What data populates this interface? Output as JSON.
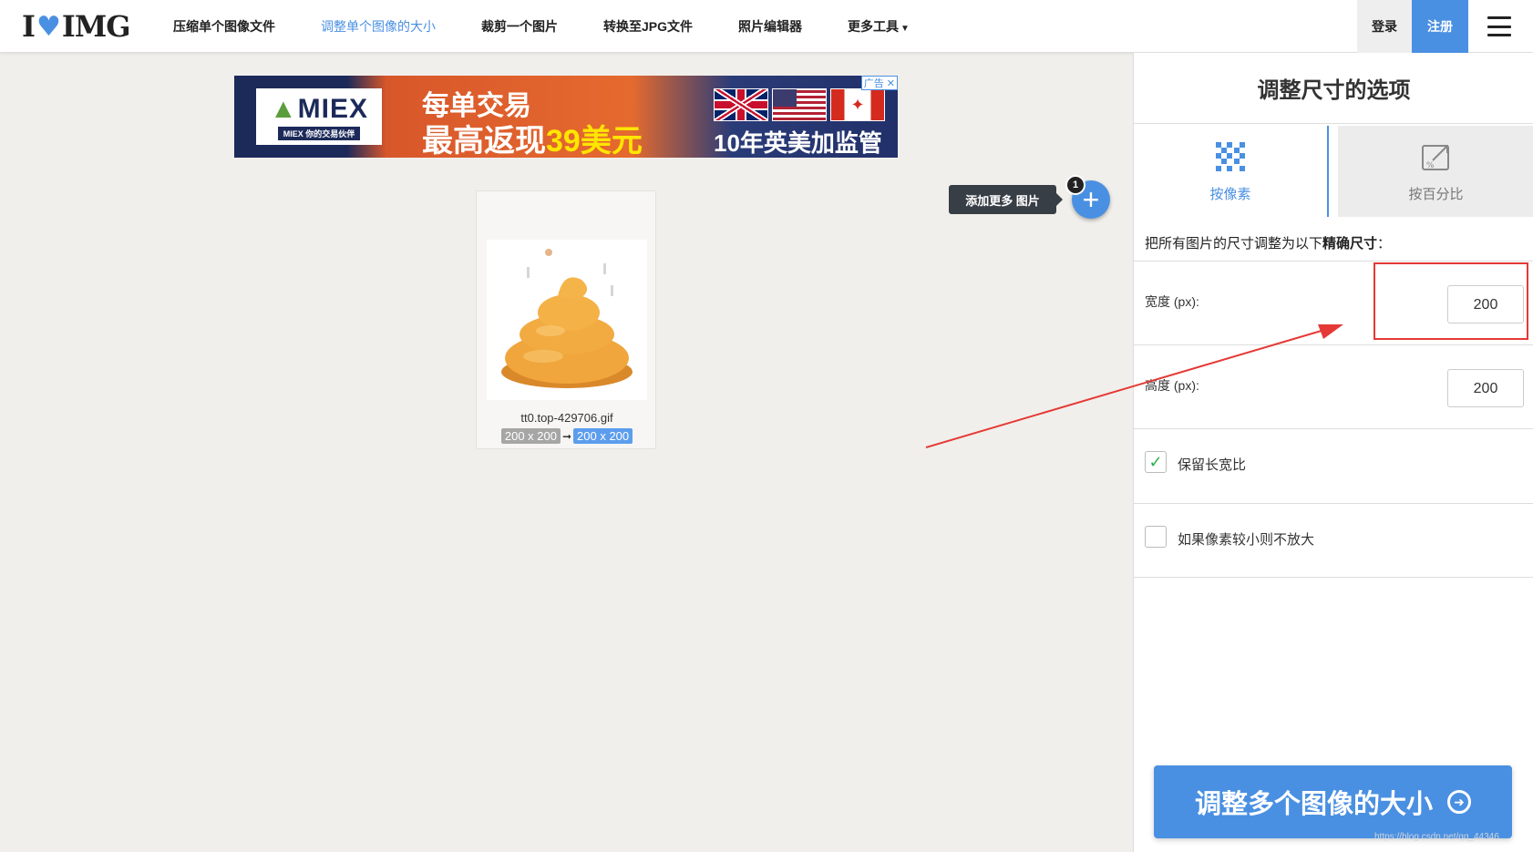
{
  "header": {
    "logo_left": "I",
    "logo_right": "IMG",
    "nav": [
      {
        "label": "压缩单个图像文件"
      },
      {
        "label": "调整单个图像的大小"
      },
      {
        "label": "裁剪一个图片"
      },
      {
        "label": "转换至JPG文件"
      },
      {
        "label": "照片编辑器"
      },
      {
        "label": "更多工具"
      }
    ],
    "login_label": "登录",
    "register_label": "注册"
  },
  "ad": {
    "brand": "MIEX",
    "brand_sub": "MIEX 你的交易伙伴",
    "line1": "每单交易",
    "line2_prefix": "最高返现",
    "line2_highlight": "39美元",
    "line3": "10年英美加监管",
    "badge": "广告"
  },
  "file": {
    "name": "tt0.top-429706.gif",
    "original_size": "200 x 200",
    "new_size": "200 x 200"
  },
  "add_more": {
    "tooltip": "添加更多 图片",
    "count": "1"
  },
  "sidebar": {
    "title": "调整尺寸的选项",
    "tabs": [
      {
        "label": "按像素",
        "active": true
      },
      {
        "label": "按百分比",
        "active": false
      }
    ],
    "instruction_prefix": "把所有图片的尺寸调整为以下",
    "instruction_bold": "精确尺寸",
    "instruction_suffix": "：",
    "width_label": "宽度 (px):",
    "width_value": "200",
    "height_label": "高度 (px):",
    "height_value": "200",
    "keep_ratio_label": "保留长宽比",
    "keep_ratio_checked": true,
    "no_enlarge_label": "如果像素较小则不放大",
    "no_enlarge_checked": false,
    "action_label": "调整多个图像的大小"
  },
  "watermark": "https://blog.csdn.net/qq_44346..."
}
